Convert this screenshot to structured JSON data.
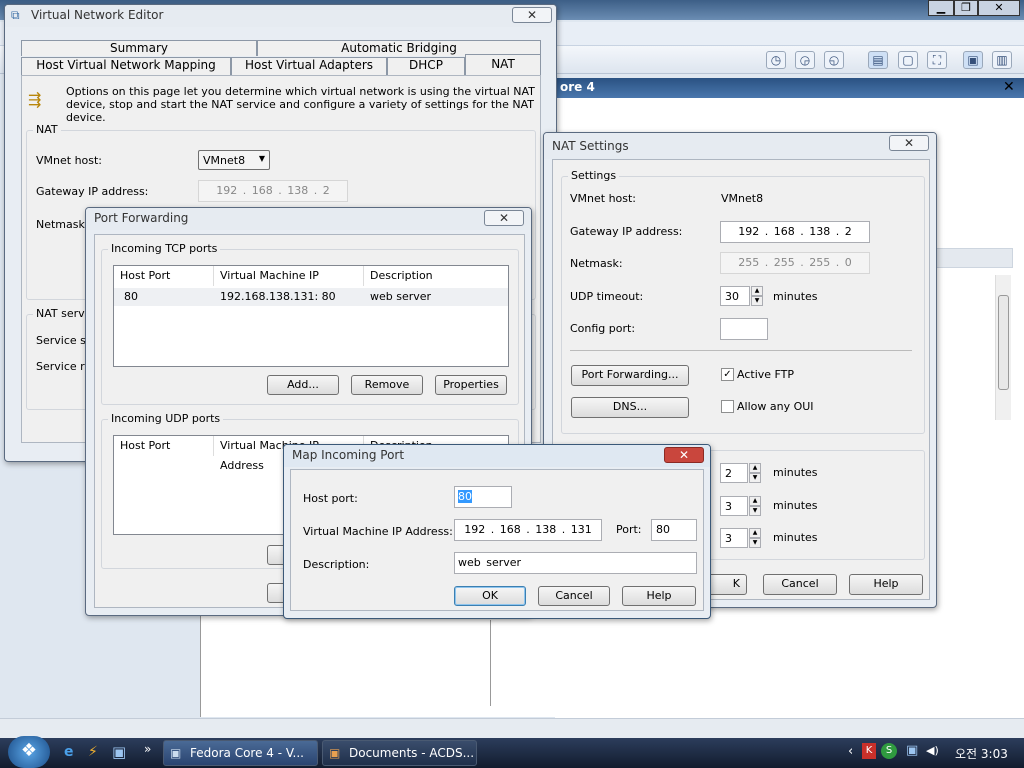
{
  "background_app": {
    "tab_title_fragment": "ore 4",
    "close_glyph": "✕",
    "window_controls": [
      "▁",
      "❐",
      "✕"
    ]
  },
  "vne": {
    "title": "Virtual Network Editor",
    "close_glyph": "✕",
    "tabs_row1": [
      "Summary",
      "Automatic Bridging"
    ],
    "tabs_row2": [
      "Host Virtual Network Mapping",
      "Host Virtual Adapters",
      "DHCP",
      "NAT"
    ],
    "info": "Options on this page let you determine which virtual network is using the virtual NAT device, stop and start the NAT service and configure a variety of settings for the NAT device.",
    "nat_group": "NAT",
    "vmnet_label": "VMnet host:",
    "vmnet_value": "VMnet8",
    "gateway_label": "Gateway IP address:",
    "gateway_value": "192 . 168 . 138 . 2",
    "netmask_label": "Netmask:",
    "service_group": "NAT servi",
    "service_row1": "Service s",
    "service_row2": "Service re"
  },
  "portfwd": {
    "title": "Port Forwarding",
    "close_glyph": "✕",
    "tcp_group": "Incoming TCP ports",
    "udp_group": "Incoming UDP ports",
    "columns": [
      "Host Port",
      "Virtual Machine IP Address",
      "Description"
    ],
    "udp_columns": [
      "Host Port",
      "Virtual Machine IP Address",
      "Description"
    ],
    "rows": [
      {
        "port": "80",
        "vm": "192.168.138.131: 80",
        "desc": "web server"
      }
    ],
    "add": "Add...",
    "remove": "Remove",
    "properties": "Properties"
  },
  "nat": {
    "title": "NAT Settings",
    "close_glyph": "✕",
    "settings_group": "Settings",
    "vmnet_label": "VMnet host:",
    "vmnet_value": "VMnet8",
    "gateway_label": "Gateway IP address:",
    "gateway_value": "192 . 168 . 138 . 2",
    "netmask_label": "Netmask:",
    "netmask_value": "255 . 255 . 255 . 0",
    "udp_label": "UDP timeout:",
    "udp_value": "30",
    "minutes": "minutes",
    "config_label": "Config port:",
    "portfwd_btn": "Port Forwarding...",
    "dns_btn": "DNS...",
    "active_ftp": "Active FTP",
    "any_oui": "Allow any OUI",
    "spin_values": [
      "2",
      "3",
      "3"
    ],
    "ok_fragment": "K",
    "cancel": "Cancel",
    "help": "Help"
  },
  "map": {
    "title": "Map Incoming Port",
    "close_glyph": "✕",
    "host_label": "Host port:",
    "host_value": "80",
    "vm_label": "Virtual Machine IP Address:",
    "vm_value": "192 . 168 . 138 . 131",
    "port_label": "Port:",
    "port_value": "80",
    "desc_label": "Description:",
    "desc_value": "web server",
    "ok": "OK",
    "cancel": "Cancel",
    "help": "Help"
  },
  "taskbar": {
    "start_glyph": "❖",
    "quicklaunch": [
      "e",
      "⚡",
      "▣",
      "»"
    ],
    "items": [
      "Fedora Core 4 - V...",
      "Documents - ACDS..."
    ],
    "tray_icons": [
      "‹",
      "K",
      "S",
      "▣",
      "◀)"
    ],
    "clock": "오전 3:03"
  },
  "colors": {
    "taskbar": "#1b2a44",
    "accent": "#3c7fb1",
    "close_red": "#c9463d"
  }
}
